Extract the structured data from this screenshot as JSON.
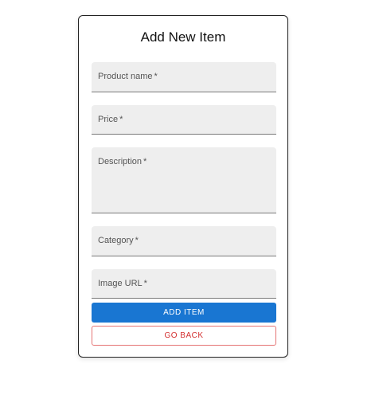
{
  "form": {
    "title": "Add New Item",
    "fields": [
      {
        "label": "Product name",
        "required_mark": "*"
      },
      {
        "label": "Price",
        "required_mark": "*"
      },
      {
        "label": "Description",
        "required_mark": "*"
      },
      {
        "label": "Category",
        "required_mark": "*"
      },
      {
        "label": "Image URL",
        "required_mark": "*"
      }
    ],
    "submit_label": "ADD ITEM",
    "back_label": "GO BACK"
  },
  "colors": {
    "primary": "#1976d2",
    "danger": "#d32f2f",
    "field_bg": "#eeeeee"
  }
}
